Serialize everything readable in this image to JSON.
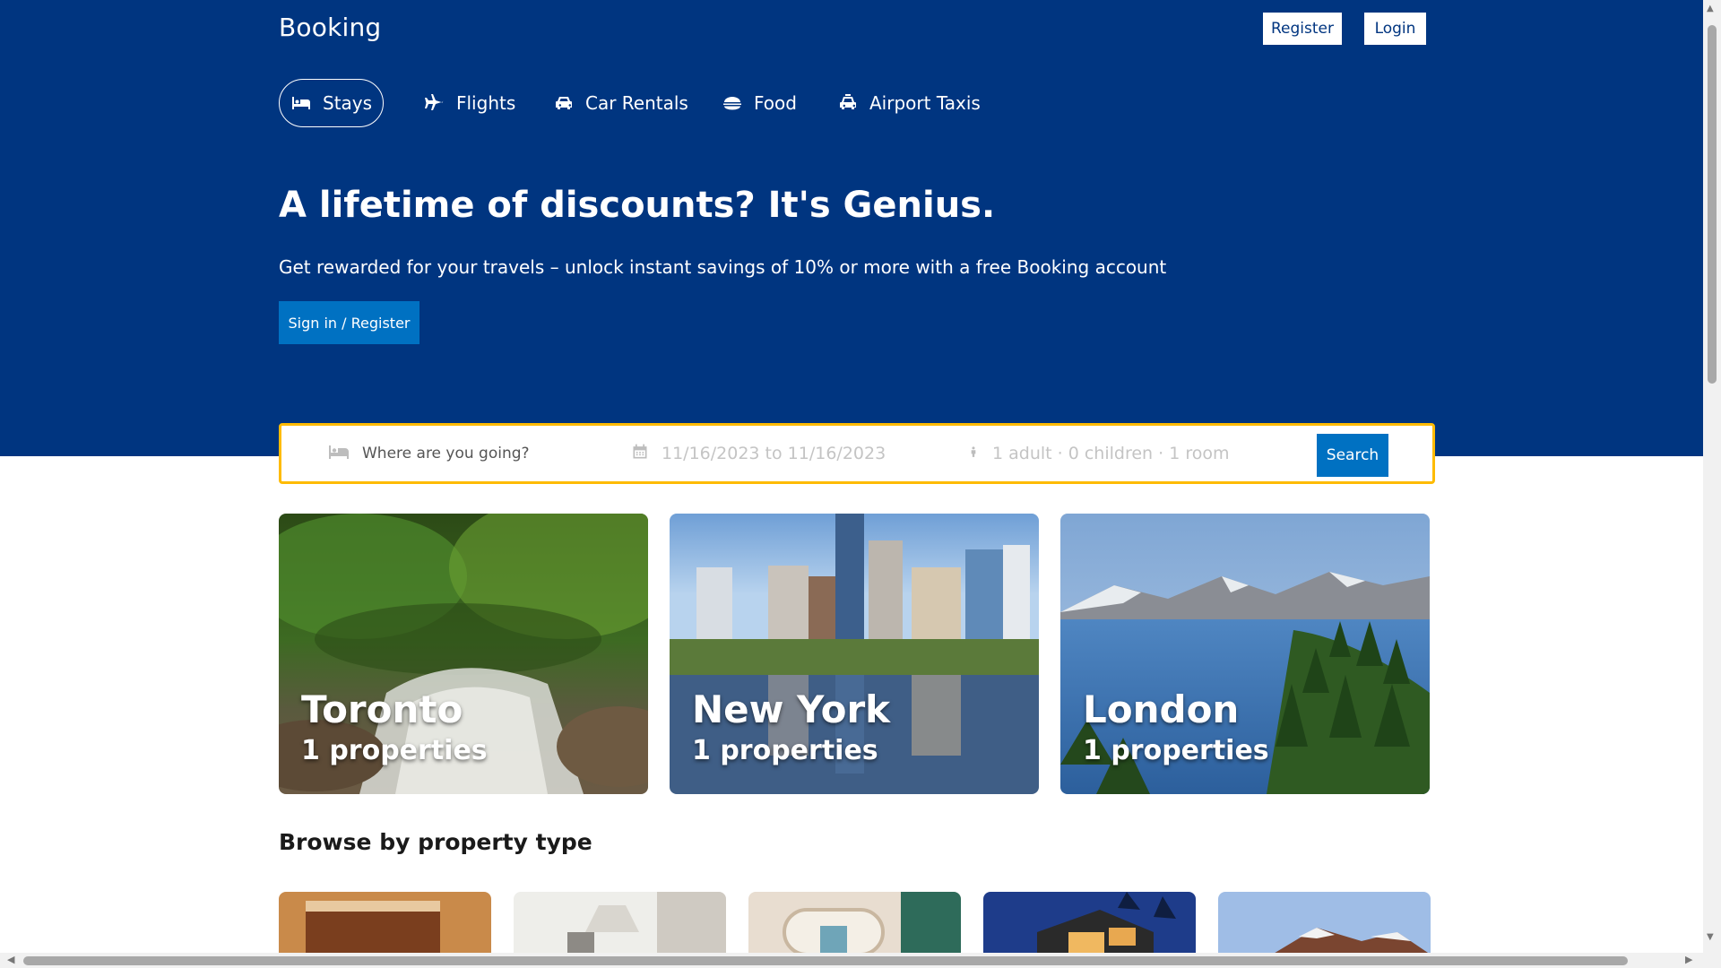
{
  "header": {
    "brand": "Booking",
    "register_label": "Register",
    "login_label": "Login"
  },
  "nav": {
    "items": [
      {
        "label": "Stays",
        "icon": "bed-icon",
        "active": true
      },
      {
        "label": "Flights",
        "icon": "plane-icon",
        "active": false
      },
      {
        "label": "Car Rentals",
        "icon": "car-icon",
        "active": false
      },
      {
        "label": "Food",
        "icon": "food-icon",
        "active": false
      },
      {
        "label": "Airport Taxis",
        "icon": "taxi-icon",
        "active": false
      }
    ]
  },
  "hero": {
    "title": "A lifetime of discounts? It's Genius.",
    "subtitle": "Get rewarded for your travels – unlock instant savings of 10% or more with a free Booking account",
    "cta_label": "Sign in / Register"
  },
  "search": {
    "destination_placeholder": "Where are you going?",
    "dates": "11/16/2023 to 11/16/2023",
    "guests": "1 adult · 0 children · 1 room",
    "button_label": "Search"
  },
  "cities": [
    {
      "name": "Toronto",
      "properties": "1 properties"
    },
    {
      "name": "New York",
      "properties": "1 properties"
    },
    {
      "name": "London",
      "properties": "1 properties"
    }
  ],
  "property_types": {
    "title": "Browse by property type"
  },
  "colors": {
    "brand_blue": "#003580",
    "action_blue": "#0071c2",
    "search_border": "#febb02"
  }
}
